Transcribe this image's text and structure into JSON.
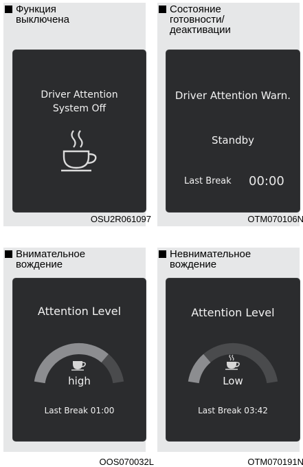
{
  "panels": [
    {
      "heading": [
        "Функция",
        "выключена"
      ],
      "screen": {
        "line1": "Driver Attention",
        "line2": "System Off",
        "icon": "coffee-cup-icon"
      },
      "code": "OSU2R061097"
    },
    {
      "heading": [
        "Состояние",
        "готовности/",
        "деактивации"
      ],
      "screen": {
        "title": "Driver Attention Warn.",
        "status": "Standby",
        "last_break_label": "Last Break",
        "last_break_time": "00:00"
      },
      "code": "OTM070106N"
    },
    {
      "heading": [
        "Внимательное",
        "вождение"
      ],
      "screen": {
        "title": "Attention Level",
        "level": "high",
        "last_break": "Last Break 01:00",
        "gauge_fraction": 0.75,
        "icon": "coffee-cup-icon"
      },
      "code": "OOS070032L"
    },
    {
      "heading": [
        "Невнимательное",
        "вождение"
      ],
      "screen": {
        "title": "Attention Level",
        "level": "Low",
        "last_break": "Last Break 03:42",
        "gauge_fraction": 0.25,
        "icon": "steaming-coffee-cup-icon"
      },
      "code": "OTM070191N"
    }
  ],
  "colors": {
    "panel": "#e6e7e8",
    "screen": "#2b2c2e",
    "text": "#f2f2f2"
  }
}
